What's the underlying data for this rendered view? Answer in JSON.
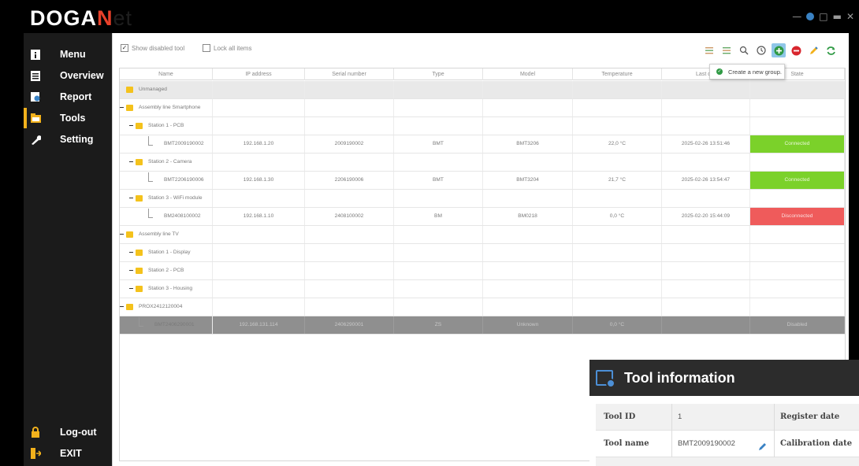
{
  "app": {
    "logo_part1": "DOGA",
    "logo_part2": "N",
    "logo_part3": "et",
    "accent": "#e8402a"
  },
  "window_controls": [
    "—",
    "●",
    "□",
    "▬",
    "✕"
  ],
  "sidebar": {
    "items": [
      {
        "label": "Menu",
        "icon": "menu-icon"
      },
      {
        "label": "Overview",
        "icon": "overview-icon"
      },
      {
        "label": "Report",
        "icon": "report-icon"
      },
      {
        "label": "Tools",
        "icon": "tools-icon",
        "active": true
      },
      {
        "label": "Setting",
        "icon": "wrench-icon"
      }
    ],
    "bottom": [
      {
        "label": "Log-out",
        "icon": "lock-icon"
      },
      {
        "label": "EXIT",
        "icon": "exit-icon"
      }
    ],
    "active_color": "#f2b11c"
  },
  "options": {
    "show_disabled": "Show disabled tool",
    "lock_all": "Lock all items"
  },
  "tooltip": {
    "text": "Create a new group."
  },
  "table": {
    "columns": [
      "Name",
      "IP address",
      "Serial number",
      "Type",
      "Model",
      "Temperature",
      "Last dat",
      "State"
    ],
    "rows": [
      {
        "name": "Unmanaged",
        "level": 0,
        "kind": "group"
      },
      {
        "name": "Assembly line Smartphone",
        "level": 0,
        "kind": "group"
      },
      {
        "name": "Station 1 - PCB",
        "level": 1,
        "kind": "group"
      },
      {
        "name": "BMT2009190002",
        "level": 2,
        "kind": "tool",
        "ip": "192.168.1.20",
        "serial": "2009190002",
        "type": "BMT",
        "model": "BMT3206",
        "temp": "22,0 °C",
        "date": "2025-02-26 13:51:46",
        "state": "Connected"
      },
      {
        "name": "Station 2 - Camera",
        "level": 1,
        "kind": "group"
      },
      {
        "name": "BMT2206190006",
        "level": 2,
        "kind": "tool",
        "ip": "192.168.1.30",
        "serial": "2206190006",
        "type": "BMT",
        "model": "BMT3204",
        "temp": "21,7 °C",
        "date": "2025-02-26 13:54:47",
        "state": "Connected"
      },
      {
        "name": "Station 3 - WiFi module",
        "level": 1,
        "kind": "group"
      },
      {
        "name": "BM2408100002",
        "level": 2,
        "kind": "tool",
        "ip": "192.168.1.10",
        "serial": "2408100002",
        "type": "BM",
        "model": "BM0218",
        "temp": "0,0 °C",
        "date": "2025-02-20 15:44:09",
        "state": "Disconnected"
      },
      {
        "name": "Assembly line TV",
        "level": 0,
        "kind": "group"
      },
      {
        "name": "Station 1 - Display",
        "level": 1,
        "kind": "group"
      },
      {
        "name": "Station 2 - PCB",
        "level": 1,
        "kind": "group"
      },
      {
        "name": "Station 3 - Housing",
        "level": 1,
        "kind": "group"
      },
      {
        "name": "PROX2412120004",
        "level": 0,
        "kind": "group"
      },
      {
        "name": "BMT2406290001",
        "level": 1,
        "kind": "tool",
        "ip": "192.168.131.114",
        "serial": "2406290001",
        "type": "ZS",
        "model": "Unknown",
        "temp": "0,0 °C",
        "date": "",
        "state": "Disabled"
      }
    ],
    "state_colors": {
      "Connected": "#7bd12a",
      "Disconnected": "#ef5b5b",
      "Disabled": "#8f8f8f"
    }
  },
  "tool_info": {
    "title": "Tool information",
    "rows": [
      {
        "k": "Tool ID",
        "v": "1",
        "k2": "Register date"
      },
      {
        "k": "Tool name",
        "v": "BMT2009190002",
        "k2": "Calibration date"
      }
    ]
  }
}
